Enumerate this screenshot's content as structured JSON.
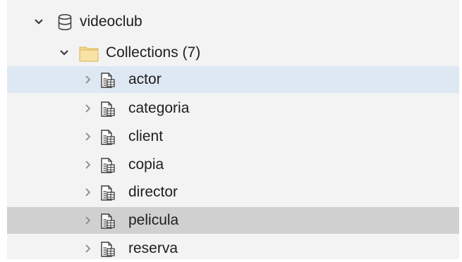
{
  "tree": {
    "database": {
      "label": "videoclub",
      "icon": "database-icon",
      "expanded": true
    },
    "collections_folder": {
      "label": "Collections (7)",
      "icon": "folder-icon",
      "expanded": true
    },
    "collections": [
      {
        "label": "actor",
        "icon": "collection-icon",
        "state": "selected"
      },
      {
        "label": "categoria",
        "icon": "collection-icon",
        "state": "normal"
      },
      {
        "label": "client",
        "icon": "collection-icon",
        "state": "normal"
      },
      {
        "label": "copia",
        "icon": "collection-icon",
        "state": "normal"
      },
      {
        "label": "director",
        "icon": "collection-icon",
        "state": "normal"
      },
      {
        "label": "pelicula",
        "icon": "collection-icon",
        "state": "hovered"
      },
      {
        "label": "reserva",
        "icon": "collection-icon",
        "state": "normal"
      }
    ]
  },
  "colors": {
    "tree_background": "#f3f3f3",
    "selected_row": "#dde8f3",
    "hovered_row": "#d0d0d0",
    "folder": "#f6d98c"
  }
}
